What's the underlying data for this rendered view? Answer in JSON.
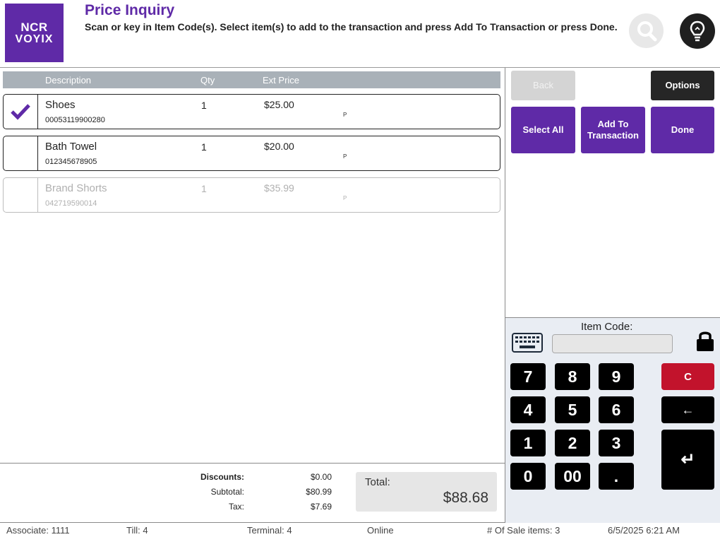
{
  "header": {
    "logo_line1": "NCR",
    "logo_line2": "VOYIX",
    "title": "Price Inquiry",
    "instructions": "Scan or key in Item Code(s). Select item(s) to add to the transaction and press Add To Transaction or press Done.",
    "search_icon": "search-icon",
    "hint_icon": "lightbulb-icon"
  },
  "table": {
    "columns": [
      "Description",
      "Qty",
      "Ext Price"
    ],
    "rows": [
      {
        "description": "Shoes",
        "code": "00053119900280",
        "qty": "1",
        "ext_price": "$25.00",
        "flag": "P",
        "selected": true,
        "enabled": true
      },
      {
        "description": "Bath Towel",
        "code": "012345678905",
        "qty": "1",
        "ext_price": "$20.00",
        "flag": "P",
        "selected": false,
        "enabled": true
      },
      {
        "description": "Brand Shorts",
        "code": "042719590014",
        "qty": "1",
        "ext_price": "$35.99",
        "flag": "P",
        "selected": false,
        "enabled": false
      }
    ]
  },
  "actions": {
    "back": "Back",
    "options": "Options",
    "select_all": "Select All",
    "add_to_transaction_line1": "Add To",
    "add_to_transaction_line2": "Transaction",
    "done": "Done"
  },
  "keypad": {
    "item_code_label": "Item Code:",
    "item_code_value": "",
    "keys": [
      "7",
      "8",
      "9",
      "4",
      "5",
      "6",
      "1",
      "2",
      "3",
      "0",
      "00",
      "."
    ],
    "clear": "C",
    "backspace": "←",
    "enter": "↵"
  },
  "summary": {
    "discounts_label": "Discounts:",
    "discounts": "$0.00",
    "subtotal_label": "Subtotal:",
    "subtotal": "$80.99",
    "tax_label": "Tax:",
    "tax": "$7.69",
    "total_label": "Total:",
    "total": "$88.68"
  },
  "footer": {
    "associate": "Associate: 1111",
    "till": "Till: 4",
    "terminal": "Terminal: 4",
    "status": "Online",
    "sale_items": "# Of Sale items: 3",
    "datetime": "6/5/2025 6:21 AM"
  },
  "colors": {
    "brand_purple": "#5f2aa7",
    "clear_red": "#c2132c",
    "header_gray": "#a9b1b8"
  }
}
